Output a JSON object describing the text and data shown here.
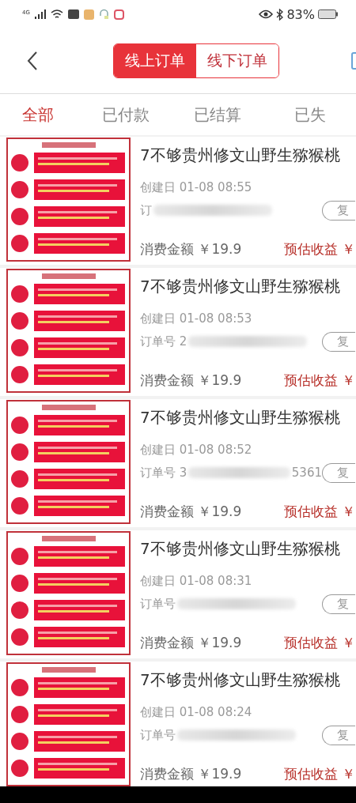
{
  "status_bar": {
    "network": "4G",
    "battery": "83%"
  },
  "header": {
    "segments": [
      {
        "label": "线上订单",
        "selected": true
      },
      {
        "label": "线下订单",
        "selected": false
      }
    ]
  },
  "tabs": [
    {
      "label": "全部",
      "selected": true
    },
    {
      "label": "已付款",
      "selected": false
    },
    {
      "label": "已结算",
      "selected": false
    },
    {
      "label": "已失",
      "selected": false
    }
  ],
  "orders": [
    {
      "title": "7不够贵州修文山野生猕猴桃",
      "created": "创建日 01-08 08:55",
      "order_label": "订",
      "copy": "复",
      "amount": "消费金额 ￥19.9",
      "earnings": "预估收益 ￥"
    },
    {
      "title": "7不够贵州修文山野生猕猴桃",
      "created": "创建日 01-08 08:53",
      "order_label": "订单号 2",
      "copy": "复",
      "amount": "消费金额 ￥19.9",
      "earnings": "预估收益 ￥"
    },
    {
      "title": "7不够贵州修文山野生猕猴桃",
      "created": "创建日 01-08 08:52",
      "order_label": "订单号 3",
      "order_suffix": "5361",
      "copy": "复",
      "amount": "消费金额 ￥19.9",
      "earnings": "预估收益 ￥"
    },
    {
      "title": "7不够贵州修文山野生猕猴桃",
      "created": "创建日 01-08 08:31",
      "order_label": "订单号",
      "copy": "复",
      "amount": "消费金额 ￥19.9",
      "earnings": "预估收益 ￥"
    },
    {
      "title": "7不够贵州修文山野生猕猴桃",
      "created": "创建日 01-08 08:24",
      "order_label": "订单号",
      "copy": "复",
      "amount": "消费金额 ￥19.9",
      "earnings": "预估收益 ￥"
    }
  ]
}
